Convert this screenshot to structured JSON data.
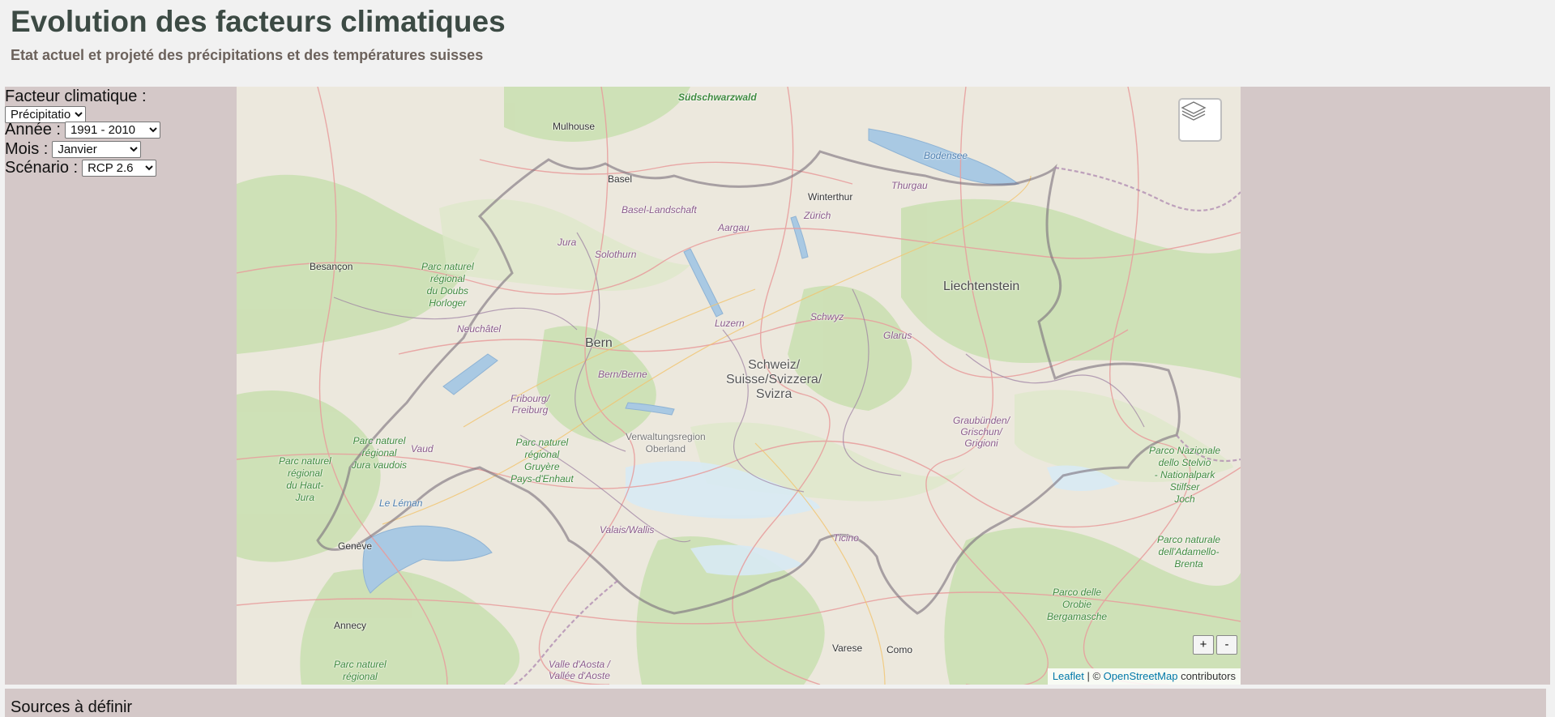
{
  "header": {
    "title": "Evolution des facteurs climatiques",
    "subtitle": "Etat actuel et projeté des précipitations et des températures suisses"
  },
  "controls": {
    "factor_label": "Facteur climatique :",
    "factor_value": "Précipitation",
    "year_label": "Année :",
    "year_value": "1991 - 2010",
    "month_label": "Mois :",
    "month_value": "Janvier",
    "scenario_label": "Scénario :",
    "scenario_value": "RCP 2.6"
  },
  "map": {
    "places": {
      "sudschwarzwald": "Südschwarzwald",
      "mulhouse": "Mulhouse",
      "basel": "Basel",
      "basel_landschaft": "Basel-Landschaft",
      "winterthur": "Winterthur",
      "zurich": "Zürich",
      "thurgau": "Thurgau",
      "bodensee": "Bodensee",
      "aargau": "Aargau",
      "jura": "Jura",
      "solothurn": "Solothurn",
      "besancon": "Besançon",
      "doubs": [
        "Parc naturel",
        "régional",
        "du Doubs",
        "Horloger"
      ],
      "liechtenstein": "Liechtenstein",
      "neuchatel": "Neuchâtel",
      "luzern": "Luzern",
      "schwyz": "Schwyz",
      "glarus": "Glarus",
      "bern": "Bern",
      "bern_berne": "Bern/Berne",
      "switzerland": [
        "Schweiz/",
        "Suisse/Svizzera/",
        "Svizra"
      ],
      "fribourg": [
        "Fribourg/",
        "Freiburg"
      ],
      "oberland": [
        "Verwaltungsregion",
        "Oberland"
      ],
      "graubunden": [
        "Graubünden/",
        "Grischun/",
        "Grigioni"
      ],
      "jura_vaudois": [
        "Parc naturel",
        "régional",
        "Jura vaudois"
      ],
      "vaud": "Vaud",
      "gruyere": [
        "Parc naturel",
        "régional",
        "Gruyère",
        "Pays-d'Enhaut"
      ],
      "haut_jura": [
        "Parc naturel",
        "régional",
        "du Haut-",
        "Jura"
      ],
      "stelvio": [
        "Parco Nazionale",
        "dello Stelvio",
        "- Nationalpark",
        "Stilfser",
        "Joch"
      ],
      "le_leman": "Le Léman",
      "geneve": "Genève",
      "valais": "Valais/Wallis",
      "ticino": "Ticino",
      "adamello": [
        "Parco naturale",
        "dell'Adamello-",
        "Brenta"
      ],
      "orobie": [
        "Parco delle",
        "Orobie",
        "Bergamasche"
      ],
      "annecy": "Annecy",
      "varese": "Varese",
      "como": "Como",
      "aosta": [
        "Valle d'Aosta /",
        "Vallée d'Aoste"
      ],
      "annecy_park": [
        "Parc naturel",
        "régional"
      ]
    },
    "zoom_in": "+",
    "zoom_out": "-",
    "attribution": {
      "leaflet": "Leaflet",
      "separator": " | © ",
      "osm": "OpenStreetMap",
      "suffix": " contributors"
    }
  },
  "footer": {
    "sources": "Sources à définir"
  }
}
